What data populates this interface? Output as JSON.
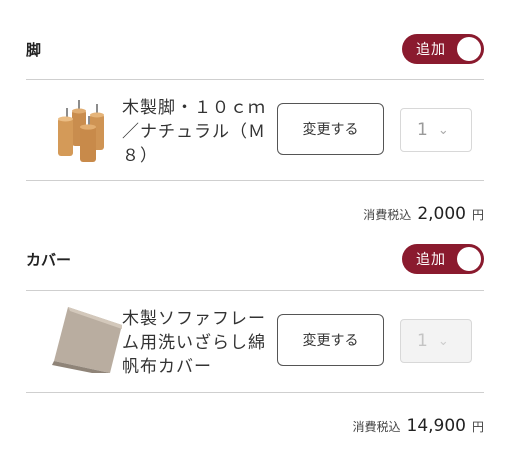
{
  "sections": [
    {
      "title": "脚",
      "toggle_label": "追加",
      "item": {
        "name": "木製脚・１０ｃｍ／ナチュラル（Ｍ８）",
        "thumb_icon": "wooden-legs-image",
        "change_label": "変更する",
        "quantity": "1",
        "quantity_disabled": false
      },
      "price": {
        "prefix": "消費税込",
        "value": "2,000",
        "unit": "円"
      }
    },
    {
      "title": "カバー",
      "toggle_label": "追加",
      "item": {
        "name": "木製ソファフレーム用洗いざらし綿帆布カバー",
        "thumb_icon": "fabric-cover-image",
        "change_label": "変更する",
        "quantity": "1",
        "quantity_disabled": true
      },
      "price": {
        "prefix": "消費税込",
        "value": "14,900",
        "unit": "円"
      }
    }
  ],
  "colors": {
    "accent": "#8a1a2e",
    "divider": "#cfcfcf"
  }
}
